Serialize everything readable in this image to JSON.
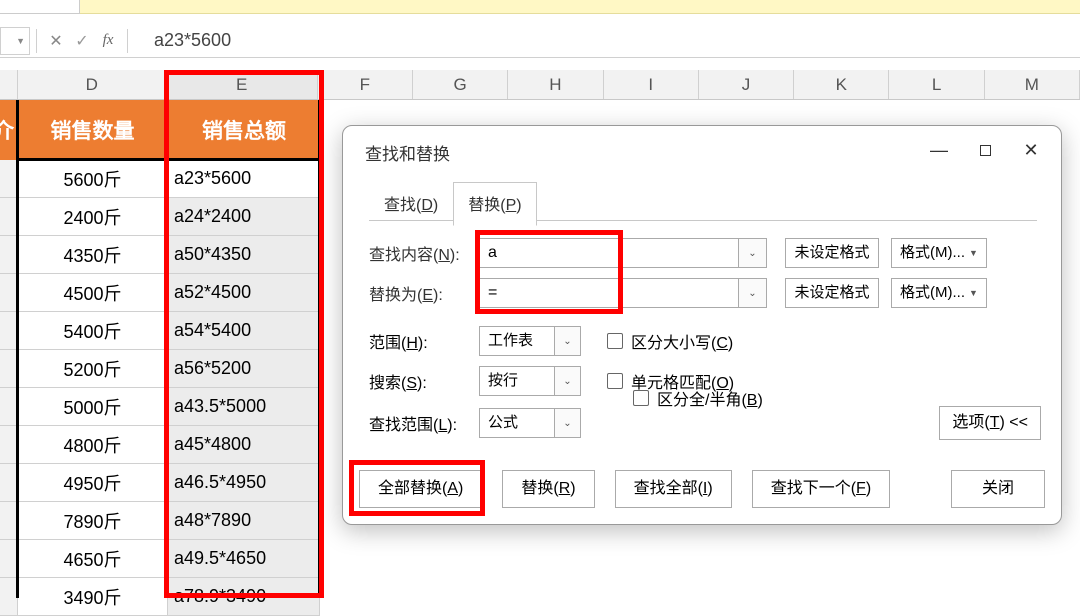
{
  "formula_bar": {
    "text": "a23*5600"
  },
  "columns": [
    "D",
    "E",
    "F",
    "G",
    "H",
    "I",
    "J",
    "K",
    "L",
    "M"
  ],
  "col_partial_left": "介",
  "header_row": {
    "D": "销售数量",
    "E": "销售总额"
  },
  "rows": [
    {
      "D": "5600斤",
      "E": "a23*5600"
    },
    {
      "D": "2400斤",
      "E": "a24*2400"
    },
    {
      "D": "4350斤",
      "E": "a50*4350"
    },
    {
      "D": "4500斤",
      "E": "a52*4500"
    },
    {
      "D": "5400斤",
      "E": "a54*5400"
    },
    {
      "D": "5200斤",
      "E": "a56*5200"
    },
    {
      "D": "5000斤",
      "E": "a43.5*5000"
    },
    {
      "D": "4800斤",
      "E": "a45*4800"
    },
    {
      "D": "4950斤",
      "E": "a46.5*4950"
    },
    {
      "D": "7890斤",
      "E": "a48*7890"
    },
    {
      "D": "4650斤",
      "E": "a49.5*4650"
    },
    {
      "D": "3490斤",
      "E": "a78.9*3490"
    }
  ],
  "dialog": {
    "title": "查找和替换",
    "tabs": {
      "find": "查找(D)",
      "replace": "替换(P)"
    },
    "find_label": "查找内容(N):",
    "replace_label": "替换为(E):",
    "find_value": "a",
    "replace_value": "=",
    "no_format": "未设定格式",
    "format_btn": "格式(M)...",
    "scope_label": "范围(H):",
    "scope_value": "工作表",
    "search_label": "搜索(S):",
    "search_value": "按行",
    "lookin_label": "查找范围(L):",
    "lookin_value": "公式",
    "chk_case": "区分大小写(C)",
    "chk_cell": "单元格匹配(O)",
    "chk_width": "区分全/半角(B)",
    "options_btn": "选项(T) <<",
    "btns": {
      "replace_all": "全部替换(A)",
      "replace_one": "替换(R)",
      "find_all": "查找全部(I)",
      "find_next": "查找下一个(F)",
      "close": "关闭"
    }
  }
}
